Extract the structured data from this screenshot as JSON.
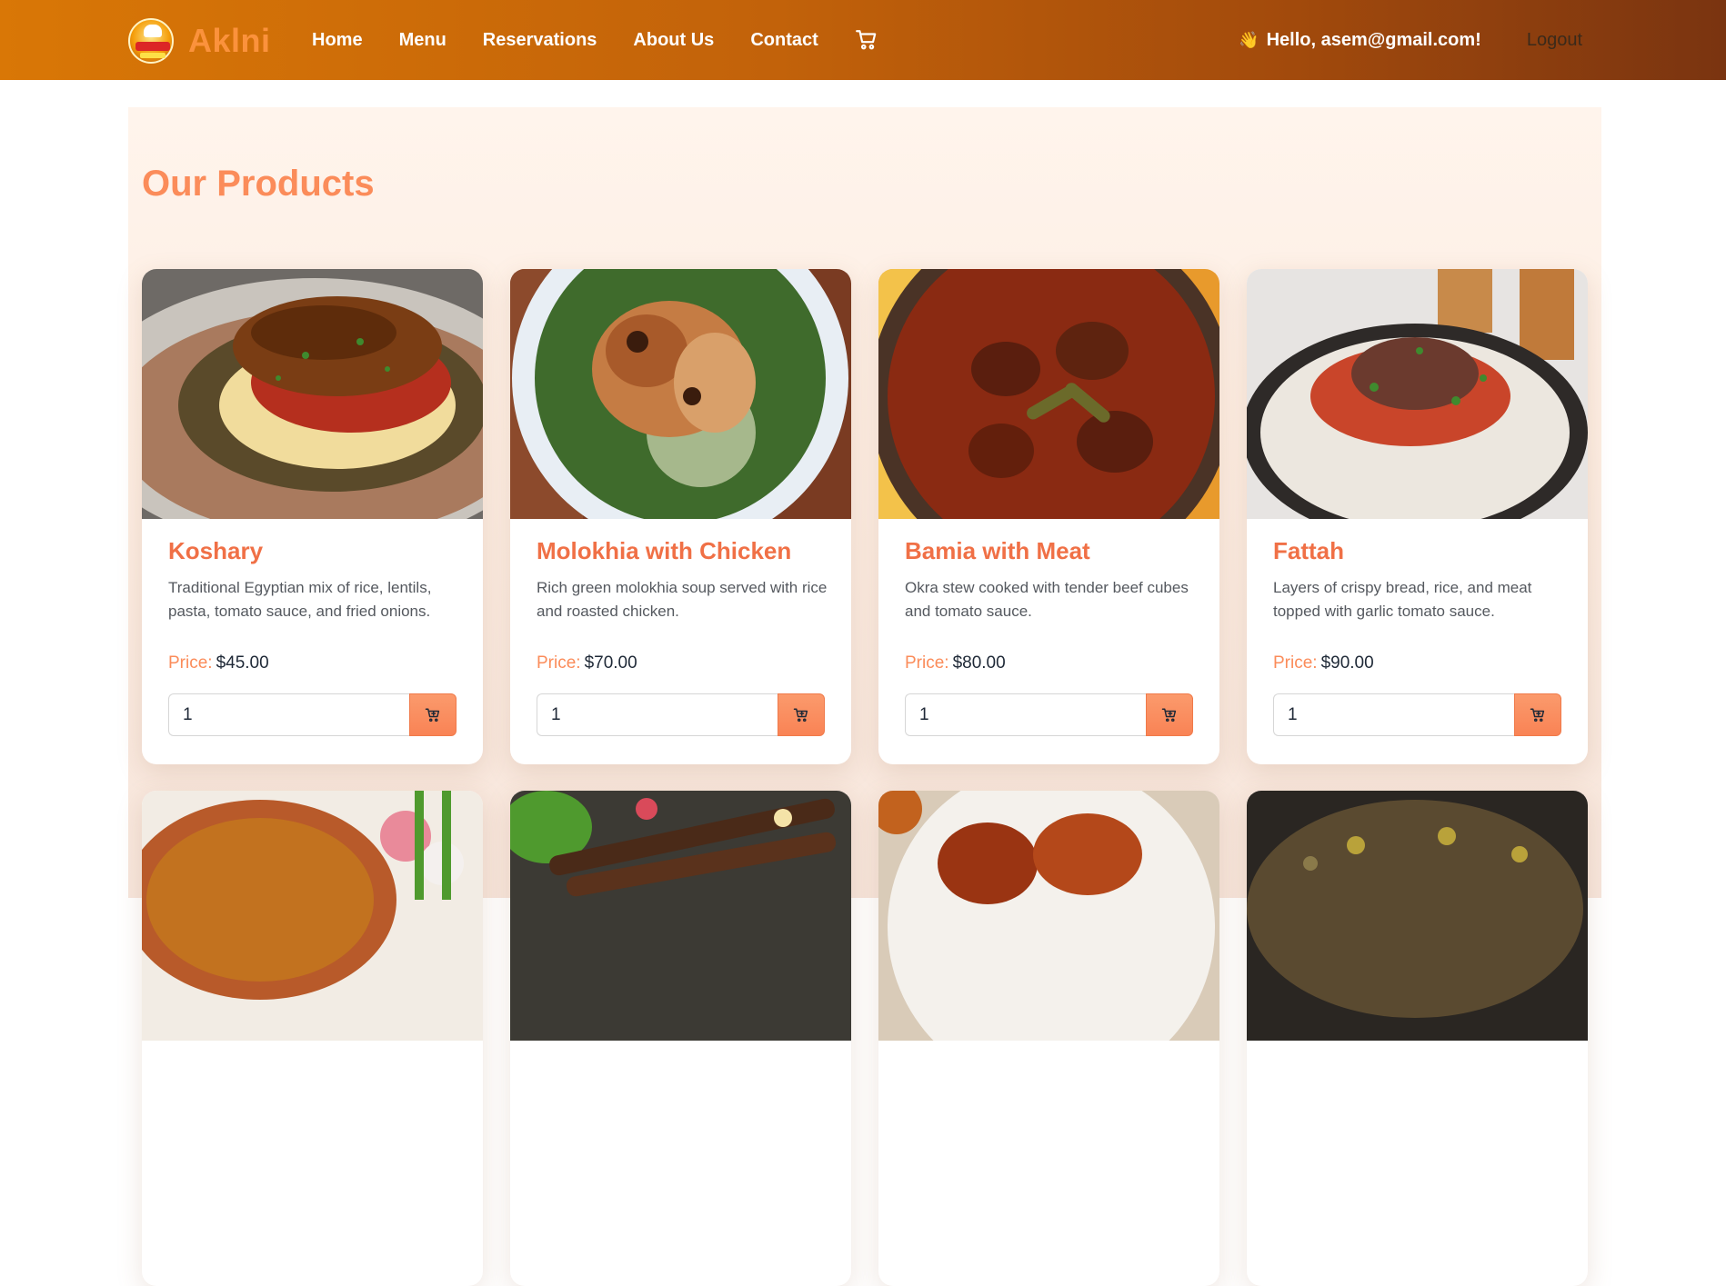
{
  "brand": {
    "name": "Aklni",
    "logo_icon": "restaurant-food-logo"
  },
  "nav": {
    "links": [
      "Home",
      "Menu",
      "Reservations",
      "About Us",
      "Contact"
    ],
    "cart_icon": "shopping-cart-icon"
  },
  "user": {
    "greeting": "Hello, asem@gmail.com!",
    "wave": "👋",
    "logout_label": "Logout"
  },
  "products_section": {
    "title": "Our Products",
    "price_label": "Price:",
    "items": [
      {
        "name": "Koshary",
        "description": "Traditional Egyptian mix of rice, lentils, pasta, tomato sauce, and fried onions.",
        "price": "$45.00",
        "quantity": "1"
      },
      {
        "name": "Molokhia with Chicken",
        "description": "Rich green molokhia soup served with rice and roasted chicken.",
        "price": "$70.00",
        "quantity": "1"
      },
      {
        "name": "Bamia with Meat",
        "description": "Okra stew cooked with tender beef cubes and tomato sauce.",
        "price": "$80.00",
        "quantity": "1"
      },
      {
        "name": "Fattah",
        "description": "Layers of crispy bread, rice, and meat topped with garlic tomato sauce.",
        "price": "$90.00",
        "quantity": "1"
      }
    ]
  },
  "colors": {
    "nav_start": "#d97706",
    "nav_end": "#7a3410",
    "accent": "#fb8c5a",
    "title": "#f07046",
    "button": "#f98355"
  }
}
